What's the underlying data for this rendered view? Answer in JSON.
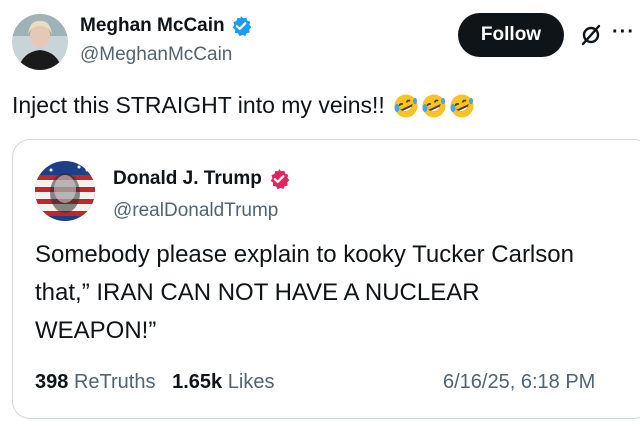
{
  "post": {
    "author_name": "Meghan McCain",
    "author_handle": "@MeghanMcCain",
    "follow_label": "Follow",
    "text": "Inject this STRAIGHT into my veins!!",
    "emojis": [
      "rolling-on-floor-laughing",
      "rolling-on-floor-laughing",
      "rolling-on-floor-laughing"
    ],
    "more_label": "···"
  },
  "quoted": {
    "author_name": "Donald J. Trump",
    "author_handle": "@realDonaldTrump",
    "text": "Somebody please explain to kooky Tucker Carlson that,” IRAN CAN NOT HAVE A NUCLEAR WEAPON!”",
    "retruths_count": "398",
    "retruths_label": "ReTruths",
    "likes_count": "1.65k",
    "likes_label": "Likes",
    "timestamp": "6/16/25, 6:18 PM"
  },
  "colors": {
    "verified_blue": "#1d9bf0",
    "verified_red": "#e0245e",
    "follow_bg": "#0f1419",
    "secondary_text": "#536471"
  }
}
